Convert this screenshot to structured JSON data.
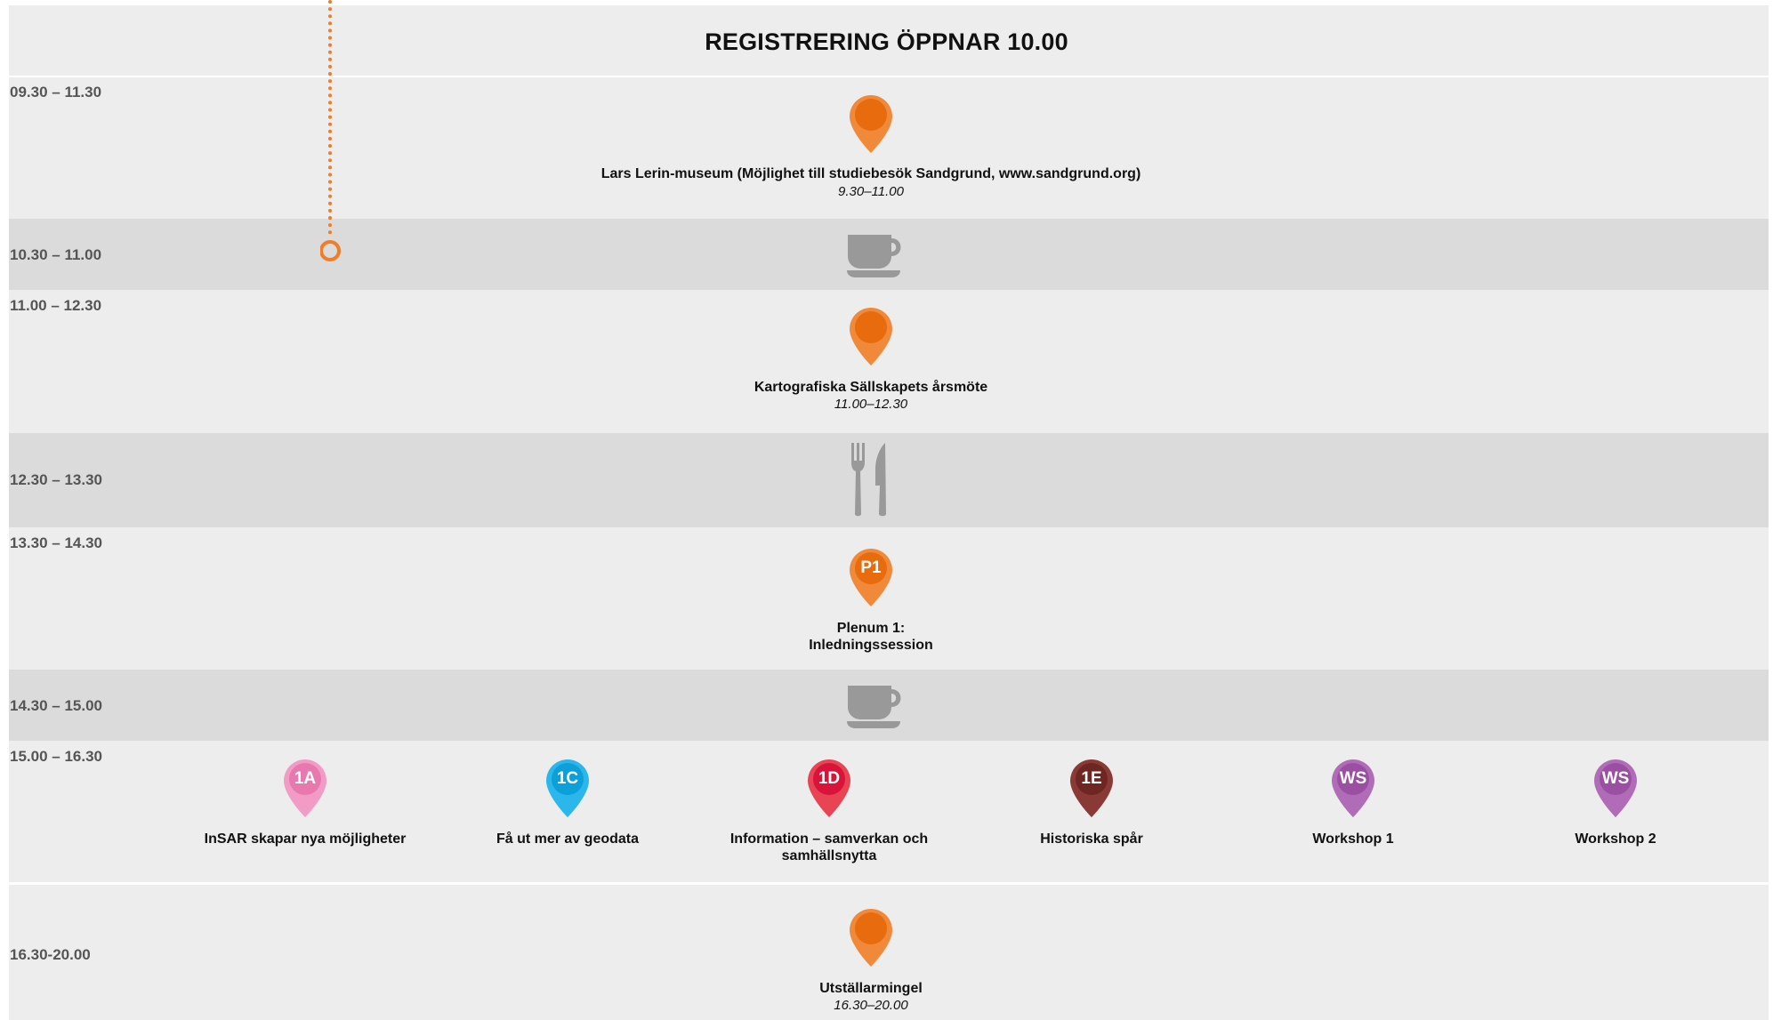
{
  "header": {
    "title": "REGISTRERING ÖPPNAR 10.00"
  },
  "colors": {
    "orange": "#ef7d2a",
    "orange_dark": "#e86b0e",
    "pink": "#ee88b8",
    "cyan": "#13a9e3",
    "red": "#e2223f",
    "brown": "#7b2e2b",
    "purple": "#a45cab",
    "grey_icon": "#999999"
  },
  "rows": [
    {
      "time": "09.30 – 11.30",
      "event": {
        "icon": "location-pin-icon",
        "title": "Lars Lerin-museum (Möjlighet till studiebesök Sandgrund, www.sandgrund.org)",
        "subtitle": "9.30–11.00"
      }
    },
    {
      "time": "10.30 – 11.00",
      "icon": "coffee-cup-icon"
    },
    {
      "time": "11.00 – 12.30",
      "event": {
        "icon": "location-pin-icon",
        "title": "Kartografiska Sällskapets årsmöte",
        "subtitle": "11.00–12.30"
      }
    },
    {
      "time": "12.30 – 13.30",
      "icon": "fork-knife-icon"
    },
    {
      "time": "13.30 – 14.30",
      "event": {
        "pin_label": "P1",
        "title_line1": "Plenum 1:",
        "title_line2": "Inledningssession"
      }
    },
    {
      "time": "14.30 – 15.00",
      "icon": "coffee-cup-icon"
    },
    {
      "time": "15.00 – 16.30",
      "sessions": [
        {
          "code": "1A",
          "title": "InSAR skapar nya möjligheter",
          "color": "#ee88b8"
        },
        {
          "code": "1C",
          "title": "Få ut mer av geodata",
          "color": "#13a9e3"
        },
        {
          "code": "1D",
          "title_line1": "Information – samverkan och",
          "title_line2": "samhällsnytta",
          "color": "#e2223f"
        },
        {
          "code": "1E",
          "title": "Historiska spår",
          "color": "#7b2e2b"
        },
        {
          "code": "WS",
          "title": "Workshop 1",
          "color": "#a45cab"
        },
        {
          "code": "WS",
          "title": "Workshop 2",
          "color": "#a45cab"
        }
      ]
    },
    {
      "time": "16.30-20.00",
      "event": {
        "icon": "location-pin-icon",
        "title": "Utställarmingel",
        "subtitle": "16.30–20.00"
      }
    }
  ]
}
